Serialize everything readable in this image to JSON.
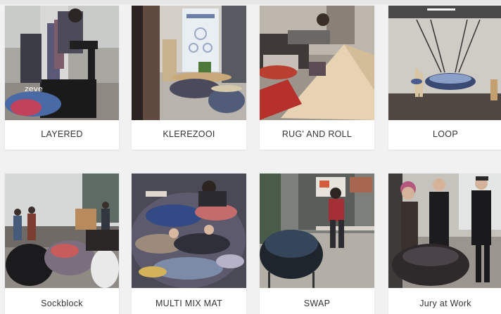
{
  "gallery": {
    "items": [
      {
        "label": "LAYERED",
        "image": "people seated on a knitted stool, piles of textile socks"
      },
      {
        "label": "KLEREZOOI",
        "image": "exhibition room with poster, plant and round textile seats"
      },
      {
        "label": "RUG' AND ROLL",
        "image": "person reclining on a rolled rug seat, wooden wedge, red rug"
      },
      {
        "label": "LOOP",
        "image": "hanging rope swing seat filled with socks in an empty hall"
      },
      {
        "label": "Sockblock",
        "image": "black sock-filled block seats with visitors in a hall"
      },
      {
        "label": "MULTI MIX MAT",
        "image": "people lying on a large colourful sock-filled mat"
      },
      {
        "label": "SWAP",
        "image": "black knitted armchair and person sitting on a table"
      },
      {
        "label": "Jury at Work",
        "image": "jury members in masks standing beside textile chair"
      }
    ]
  }
}
